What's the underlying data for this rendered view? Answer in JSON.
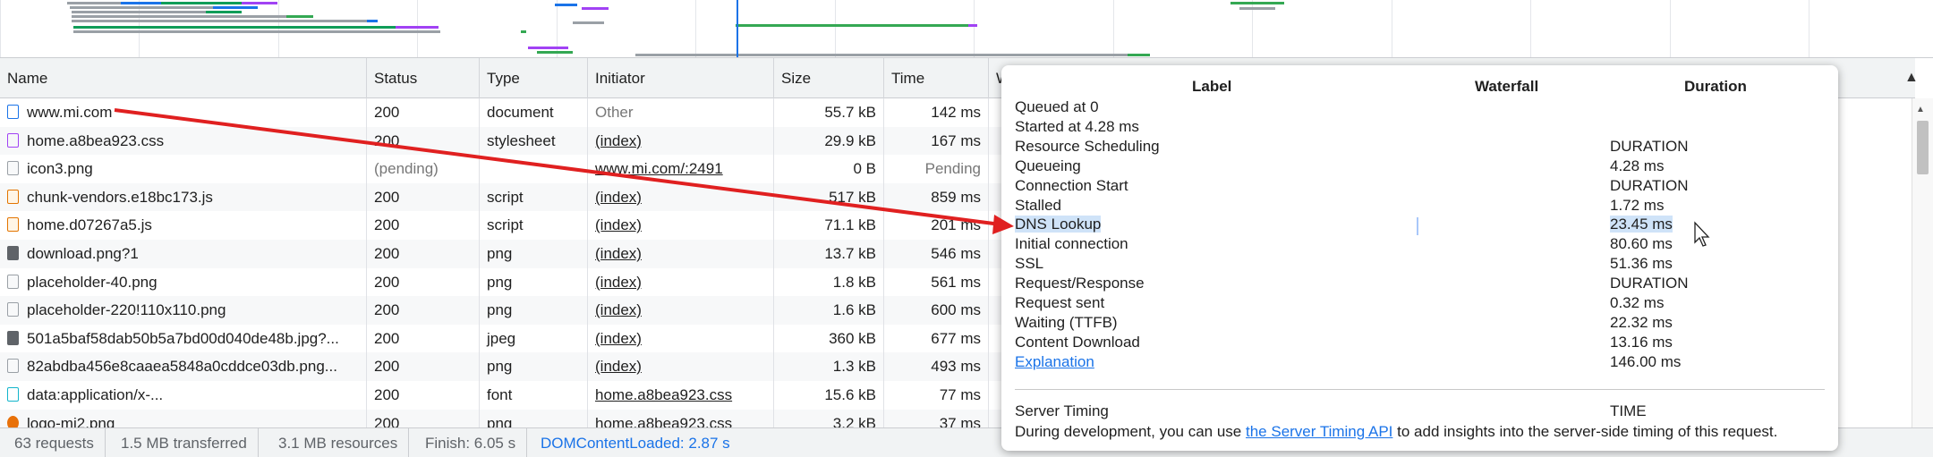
{
  "overview": {
    "bars": [
      {
        "c": "#9aa0a6"
      },
      {
        "c": "#1a73e8"
      },
      {
        "c": "#0f9d58"
      },
      {
        "c": "#a142f4"
      },
      {
        "c": "#9aa0a6"
      },
      {
        "c": "#1a73e8"
      },
      {
        "c": "#9aa0a6"
      },
      {
        "c": "#0f9d58"
      },
      {
        "c": "#9aa0a6"
      },
      {
        "c": "#34a853"
      },
      {
        "c": "#9aa0a6"
      },
      {
        "c": "#1a73e8"
      },
      {
        "c": "#0f9d58"
      },
      {
        "c": "#a142f4"
      },
      {
        "c": "#9aa0a6"
      },
      {
        "c": "#34a853"
      },
      {
        "c": "#1a73e8"
      },
      {
        "c": "#a142f4"
      },
      {
        "c": "#9aa0a6"
      },
      {
        "c": "#34a853"
      },
      {
        "c": "#9aa0a6"
      },
      {
        "c": "#a142f4"
      },
      {
        "c": "#34a853"
      },
      {
        "c": "#a142f4"
      },
      {
        "c": "#34a853"
      },
      {
        "c": "#9aa0a6"
      },
      {
        "c": "#34a853"
      }
    ]
  },
  "columns": [
    "Name",
    "Status",
    "Type",
    "Initiator",
    "Size",
    "Time",
    "W"
  ],
  "rows": [
    {
      "icon": "doc",
      "name": "www.mi.com",
      "status": "200",
      "type": "document",
      "initiator": "Other",
      "initiator_link": false,
      "size": "55.7 kB",
      "time": "142 ms"
    },
    {
      "icon": "css",
      "name": "home.a8bea923.css",
      "status": "200",
      "type": "stylesheet",
      "initiator": "(index)",
      "initiator_link": true,
      "size": "29.9 kB",
      "time": "167 ms"
    },
    {
      "icon": "img",
      "name": "icon3.png",
      "status": "(pending)",
      "type": "",
      "initiator": "www.mi.com/:2491",
      "initiator_link": true,
      "size": "0 B",
      "time": "Pending",
      "muted": true
    },
    {
      "icon": "js",
      "name": "chunk-vendors.e18bc173.js",
      "status": "200",
      "type": "script",
      "initiator": "(index)",
      "initiator_link": true,
      "size": "517 kB",
      "time": "859 ms"
    },
    {
      "icon": "js",
      "name": "home.d07267a5.js",
      "status": "200",
      "type": "script",
      "initiator": "(index)",
      "initiator_link": true,
      "size": "71.1 kB",
      "time": "201 ms"
    },
    {
      "icon": "imgdark",
      "name": "download.png?1",
      "status": "200",
      "type": "png",
      "initiator": "(index)",
      "initiator_link": true,
      "size": "13.7 kB",
      "time": "546 ms"
    },
    {
      "icon": "img",
      "name": "placeholder-40.png",
      "status": "200",
      "type": "png",
      "initiator": "(index)",
      "initiator_link": true,
      "size": "1.8 kB",
      "time": "561 ms"
    },
    {
      "icon": "img",
      "name": "placeholder-220!110x110.png",
      "status": "200",
      "type": "png",
      "initiator": "(index)",
      "initiator_link": true,
      "size": "1.6 kB",
      "time": "600 ms"
    },
    {
      "icon": "imgdark",
      "name": "501a5baf58dab50b5a7bd00d040de48b.jpg?...",
      "status": "200",
      "type": "jpeg",
      "initiator": "(index)",
      "initiator_link": true,
      "size": "360 kB",
      "time": "677 ms"
    },
    {
      "icon": "img",
      "name": "82abdba456e8caaea5848a0cddce03db.png...",
      "status": "200",
      "type": "png",
      "initiator": "(index)",
      "initiator_link": true,
      "size": "1.3 kB",
      "time": "493 ms"
    },
    {
      "icon": "font",
      "name": "data:application/x-...",
      "status": "200",
      "type": "font",
      "initiator": "home.a8bea923.css",
      "initiator_link": true,
      "size": "15.6 kB",
      "time": "77 ms"
    },
    {
      "icon": "logo",
      "name": "logo-mi2.png",
      "status": "200",
      "type": "png",
      "initiator": "home.a8bea923.css",
      "initiator_link": true,
      "size": "3.2 kB",
      "time": "37 ms"
    }
  ],
  "statusbar": {
    "requests": "63 requests",
    "transferred": "1.5 MB transferred",
    "resources": "3.1 MB resources",
    "finish": "Finish: 6.05 s",
    "dcl": "DOMContentLoaded: 2.87 s"
  },
  "popup": {
    "headers": {
      "label": "Label",
      "waterfall": "Waterfall",
      "duration": "Duration"
    },
    "lines": [
      {
        "label": "Queued at 0",
        "duration": ""
      },
      {
        "label": "Started at 4.28 ms",
        "duration": ""
      },
      {
        "label": "Resource Scheduling",
        "duration": "DURATION"
      },
      {
        "label": "Queueing",
        "duration": "4.28 ms"
      },
      {
        "label": "Connection Start",
        "duration": "DURATION"
      },
      {
        "label": "Stalled",
        "duration": "1.72 ms"
      },
      {
        "label": "DNS Lookup",
        "duration": "23.45 ms",
        "highlight": true
      },
      {
        "label": "Initial connection",
        "duration": "80.60 ms"
      },
      {
        "label": "SSL",
        "duration": "51.36 ms"
      },
      {
        "label": "Request/Response",
        "duration": "DURATION"
      },
      {
        "label": "Request sent",
        "duration": "0.32 ms"
      },
      {
        "label": "Waiting (TTFB)",
        "duration": "22.32 ms"
      },
      {
        "label": "Content Download",
        "duration": "13.16 ms"
      },
      {
        "label": "Explanation",
        "duration": "146.00 ms",
        "link": true
      }
    ],
    "server_timing": {
      "label": "Server Timing",
      "duration": "TIME"
    },
    "footer": {
      "prefix": "During development, you can use ",
      "link": "the Server Timing API",
      "suffix": " to add insights into the server-side timing of this request."
    }
  },
  "annotation": {
    "arrow_color": "#e02020"
  }
}
